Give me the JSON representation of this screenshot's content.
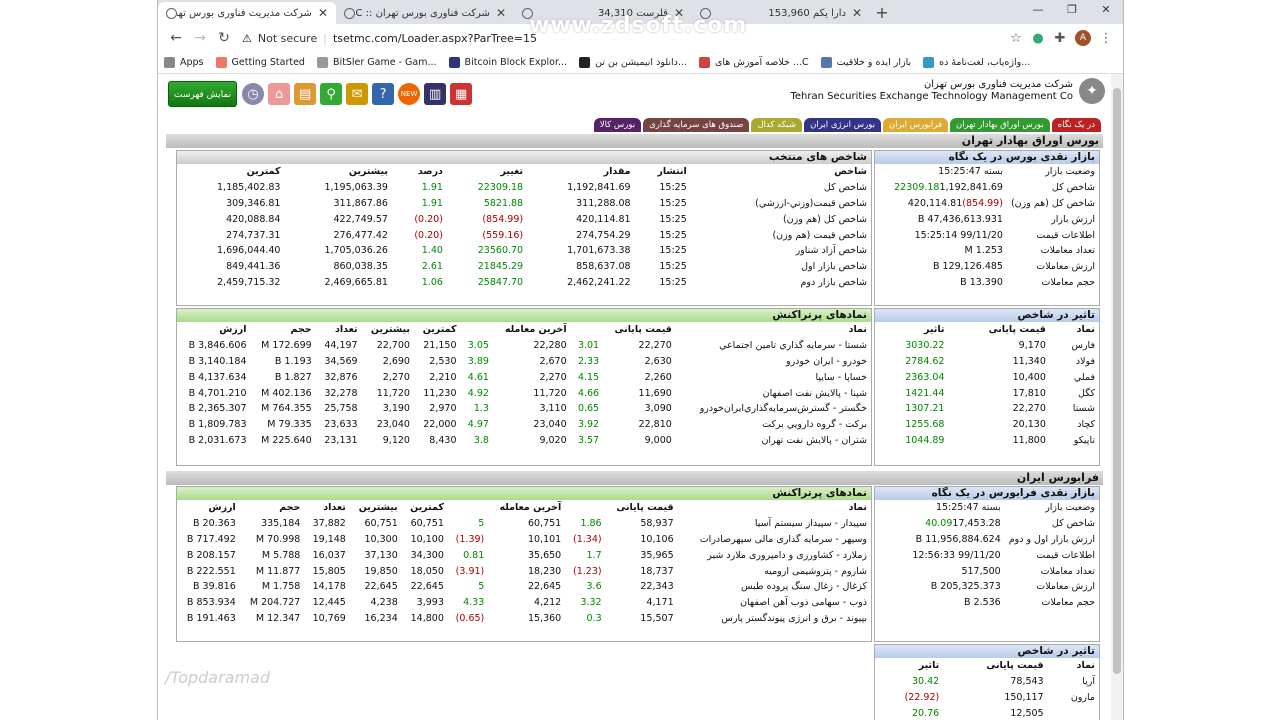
{
  "browser": {
    "tabs": [
      {
        "title": "شرکت مدیریت فناوری بورس تهران :: TSETMC.",
        "active": true
      },
      {
        "title": "شرکت فناوری بورس تهران :: TSETMC.",
        "active": false
      },
      {
        "title": "قلرست 34,310",
        "active": false
      },
      {
        "title": "دارا یکم 153,960",
        "active": false
      }
    ],
    "not_secure": "Not secure",
    "url": "tsetmc.com/Loader.aspx?ParTree=15",
    "bookmarks": [
      "Apps",
      "Getting Started",
      "BitSler Game - Gam...",
      "Bitcoin Block Explor...",
      "دانلود انیمیشن بن تن...",
      "خلاصه آموزش های ...C",
      "بازار ایده و خلاقیت",
      "واژه‌یاب، لغت‌نامهٔ ده..."
    ],
    "avatar": "A",
    "watermark": "www.zdsoft.com"
  },
  "site": {
    "list_button": "نمایش فهرست",
    "logo_fa": "شرکت مدیریت فناوری بورس تهران",
    "logo_en": "Tehran Securities Exchange Technology Management  Co",
    "nav_row1": [
      "در یک نگاه",
      "بورس اوراق بهادار تهران",
      "فرابورس ایران",
      "بورس انرژی ایران",
      "شبکه کدال",
      "صندوق های سرمایه گذاری",
      "بورس کالا"
    ],
    "tse_title": "بورس اوراق بهادار تهران",
    "tse_glance_title": "بازار نقدی بورس در یک نگاه",
    "tse_glance": [
      [
        "وضعیت بازار",
        "بسته 15:25:47",
        ""
      ],
      [
        "شاخص کل",
        "1,192,841.69",
        "22309.18"
      ],
      [
        "شاخص کل (هم وزن)",
        "420,114.81",
        "(854.99)"
      ],
      [
        "ارزش بازار",
        "47,436,613.931 B",
        ""
      ],
      [
        "اطلاعات قیمت",
        "99/11/20 15:25:14",
        ""
      ],
      [
        "تعداد معاملات",
        "1.253 M",
        ""
      ],
      [
        "ارزش معاملات",
        "129,126.485 B",
        ""
      ],
      [
        "حجم معاملات",
        "13.390 B",
        ""
      ]
    ],
    "indices_title": "شاخص های منتخب",
    "indices_head": [
      "شاخص",
      "انتشار",
      "مقدار",
      "تغییر",
      "درصد",
      "بیشترین",
      "کمترین"
    ],
    "indices": [
      [
        "شاخص کل",
        "15:25",
        "1,192,841.69",
        "22309.18",
        "1.91",
        "1,195,063.39",
        "1,185,402.83"
      ],
      [
        "شاخص قیمت(وزني-ارزشي)",
        "15:25",
        "311,288.08",
        "5821.88",
        "1.91",
        "311,867.86",
        "309,346.81"
      ],
      [
        "شاخص کل (هم وزن)",
        "15:25",
        "420,114.81",
        "(854.99)",
        "(0.20)",
        "422,749.57",
        "420,088.84"
      ],
      [
        "شاخص قیمت (هم وزن)",
        "15:25",
        "274,754.29",
        "(559.16)",
        "(0.20)",
        "276,477.42",
        "274,737.31"
      ],
      [
        "شاخص آزاد شناور",
        "15:25",
        "1,701,673.38",
        "23560.70",
        "1.40",
        "1,705,036.26",
        "1,696,044.40"
      ],
      [
        "شاخص بازار اول",
        "15:25",
        "858,637.08",
        "21845.29",
        "2.61",
        "860,038.35",
        "849,441.36"
      ],
      [
        "شاخص بازار دوم",
        "15:25",
        "2,462,241.22",
        "25847.70",
        "1.06",
        "2,469,665.81",
        "2,459,715.32"
      ]
    ],
    "impact_title": "تاثیر در شاخص",
    "impact_head": [
      "نماد",
      "قیمت پایانی",
      "تاثیر"
    ],
    "impact": [
      [
        "فارس",
        "9,170",
        "3030.22"
      ],
      [
        "فولاد",
        "11,340",
        "2784.62"
      ],
      [
        "فملي",
        "10,400",
        "2363.04"
      ],
      [
        "كگل",
        "17,810",
        "1421.44"
      ],
      [
        "شستا",
        "22,270",
        "1307.21"
      ],
      [
        "کچاد",
        "20,130",
        "1255.68"
      ],
      [
        "تاپیکو",
        "11,800",
        "1044.89"
      ]
    ],
    "top_title": "نمادهای پرتراکنش",
    "top_head": [
      "نماد",
      "قیمت پایانی",
      "",
      "آخرین معامله",
      "",
      "کمترین",
      "بیشترین",
      "تعداد",
      "حجم",
      "ارزش"
    ],
    "top": [
      [
        "شستا - سرمايه گذاري تامين اجتماعي",
        "22,270",
        "3.01",
        "22,280",
        "3.05",
        "21,150",
        "22,700",
        "44,197",
        "172.699 M",
        "3,846.606 B"
      ],
      [
        "خودرو - ايران خودرو",
        "2,630",
        "2.33",
        "2,670",
        "3.89",
        "2,530",
        "2,690",
        "34,569",
        "1.193 B",
        "3,140.184 B"
      ],
      [
        "خساپا - سايپا",
        "2,260",
        "4.15",
        "2,270",
        "4.61",
        "2,210",
        "2,270",
        "32,876",
        "1.827 B",
        "4,137.634 B"
      ],
      [
        "شپنا - پالایش نفت اصفهان",
        "11,690",
        "4.66",
        "11,720",
        "4.92",
        "11,230",
        "11,720",
        "32,278",
        "402.136 M",
        "4,701.210 B"
      ],
      [
        "خگستر - گسترش‌سرمايه‌گذاري‌ايران‌خودرو",
        "3,090",
        "0.65",
        "3,110",
        "1.3",
        "2,970",
        "3,190",
        "25,758",
        "764.355 M",
        "2,365.307 B"
      ],
      [
        "برکت - گروه دارويي بركت",
        "22,810",
        "3.92",
        "23,040",
        "4.97",
        "22,000",
        "23,040",
        "23,633",
        "79.335 M",
        "1,809.783 B"
      ],
      [
        "شتران - پالايش نفت تهران",
        "9,000",
        "3.57",
        "9,020",
        "3.8",
        "8,430",
        "9,120",
        "23,131",
        "225.640 M",
        "2,031.673 B"
      ]
    ],
    "ifb_title": "فرابورس ایران",
    "ifb_glance_title": "بازار نقدی فرابورس در یک نگاه",
    "ifb_glance": [
      [
        "وضعیت بازار",
        "بسته 15:25:47",
        ""
      ],
      [
        "شاخص کل",
        "17,453.28",
        "40.09"
      ],
      [
        "ارزش بازار اول و دوم",
        "11,956,884.624 B",
        ""
      ],
      [
        "اطلاعات قیمت",
        "99/11/20 12:56:33",
        ""
      ],
      [
        "تعداد معاملات",
        "517,500",
        ""
      ],
      [
        "ارزش معاملات",
        "205,325.373 B",
        ""
      ],
      [
        "حجم معاملات",
        "2.536 B",
        ""
      ]
    ],
    "ifb_top": [
      [
        "سپيدار - سپيداز سيستم آسيا",
        "58,937",
        "1.86",
        "60,751",
        "5",
        "60,751",
        "60,751",
        "37,882",
        "335,184",
        "20.363 B"
      ],
      [
        "وسپهر - سرمایه گذاری مالی سپهرصادرات",
        "10,106",
        "(1.34)",
        "10,101",
        "(1.39)",
        "10,100",
        "10,300",
        "19,148",
        "70.998 M",
        "717.492 B"
      ],
      [
        "زملارد - کشاورزی و دامپروری ملارد شیر",
        "35,965",
        "1.7",
        "35,650",
        "0.81",
        "34,300",
        "37,130",
        "16,037",
        "5.788 M",
        "208.157 B"
      ],
      [
        "شاروم - پتروشیمی ارومیه",
        "18,737",
        "(1.23)",
        "18,230",
        "(3.91)",
        "18,050",
        "19,850",
        "15,805",
        "11.877 M",
        "222.551 B"
      ],
      [
        "کزغال - زغال سنگ پروده طبس",
        "22,343",
        "3.6",
        "22,645",
        "5",
        "22,645",
        "22,645",
        "14,178",
        "1.758 M",
        "39.816 B"
      ],
      [
        "ذوب - سهامی ذوب آهن اصفهان",
        "4,171",
        "3.32",
        "4,212",
        "4.33",
        "3,993",
        "4,238",
        "12,445",
        "204.727 M",
        "853.934 B"
      ],
      [
        "بپيوند - برق و انرژی پیوندگستر پارس",
        "15,507",
        "0.3",
        "15,360",
        "(0.65)",
        "14,800",
        "16,234",
        "10,769",
        "12.347 M",
        "191.463 B"
      ]
    ],
    "ifb_impact": [
      [
        "آریا",
        "78,543",
        "30.42"
      ],
      [
        "مارون",
        "150,117",
        "(22.92)"
      ],
      [
        "",
        "12,505",
        "20.76"
      ]
    ],
    "footer_watermark": "/Topdaramad"
  }
}
